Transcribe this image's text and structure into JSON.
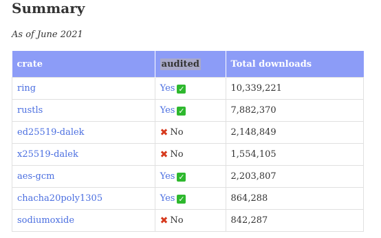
{
  "title": "Summary",
  "subtitle": "As of June 2021",
  "table": {
    "headers": [
      "crate",
      "audited",
      "Total downloads"
    ],
    "rows": [
      {
        "crate": "ring",
        "audited": "Yes",
        "audited_icon": "check-icon",
        "downloads": "10,339,221"
      },
      {
        "crate": "rustls",
        "audited": "Yes",
        "audited_icon": "check-icon",
        "downloads": "7,882,370"
      },
      {
        "crate": "ed25519-dalek",
        "audited": "No",
        "audited_icon": "cross-icon",
        "downloads": "2,148,849"
      },
      {
        "crate": "x25519-dalek",
        "audited": "No",
        "audited_icon": "cross-icon",
        "downloads": "1,554,105"
      },
      {
        "crate": "aes-gcm",
        "audited": "Yes",
        "audited_icon": "check-icon",
        "downloads": "2,203,807"
      },
      {
        "crate": "chacha20poly1305",
        "audited": "Yes",
        "audited_icon": "check-icon",
        "downloads": "864,288"
      },
      {
        "crate": "sodiumoxide",
        "audited": "No",
        "audited_icon": "cross-icon",
        "downloads": "842,287"
      }
    ]
  },
  "colors": {
    "header_bg": "#8c9cf7",
    "link": "#4a6ee0",
    "check": "#2eb82e",
    "cross": "#d63a1e"
  }
}
